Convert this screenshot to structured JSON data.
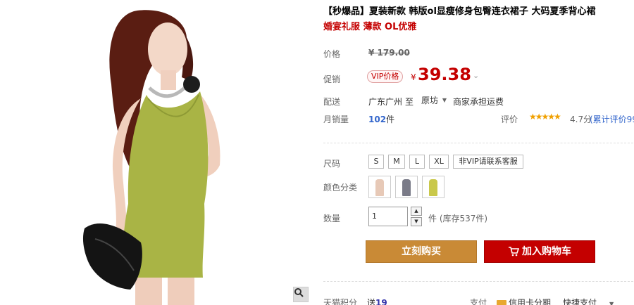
{
  "product": {
    "title_main": "【秒爆品】夏装新款 韩版ol显瘦修身包臀连衣裙子 大码夏季背心裙",
    "title_sub": "婚宴礼服 薄款 OL优雅"
  },
  "price": {
    "label": "价格",
    "original": "¥ 179.00",
    "promo_label": "促销",
    "vip_tag": "VIP价格",
    "currency": "¥",
    "promo": "39.38",
    "chevron": "⌄"
  },
  "shipping": {
    "label": "配送",
    "from": "广东广州",
    "to_label": "至",
    "destination": "原坊",
    "fee": "商家承担运费"
  },
  "sales": {
    "label": "月销量",
    "count": "102",
    "unit": "件",
    "review_label": "评价",
    "stars": "★★★★★",
    "rating": "4.7分",
    "review_link": "(累计评价99"
  },
  "sizes": {
    "label": "尺码",
    "options": [
      "S",
      "M",
      "L",
      "XL",
      "非VIP请联系客服"
    ]
  },
  "colors": {
    "label": "颜色分类",
    "swatches": [
      "#e7c9b7",
      "#7a7b88",
      "#c9c84a"
    ]
  },
  "quantity": {
    "label": "数量",
    "value": "1",
    "stock_text": "件 (库存537件)"
  },
  "actions": {
    "buy_now": "立刻购买",
    "add_cart": "加入购物车"
  },
  "footer": {
    "points_label": "天猫积分",
    "points_prefix": "送",
    "points_value": "19",
    "pay_label": "支付",
    "credit": "信用卡分期",
    "quickpay": "快捷支付",
    "dropdown": "▼"
  },
  "colors_theme": {
    "accent_red": "#c40000",
    "buy_orange": "#c98a36",
    "dress_green": "#a9b445"
  }
}
